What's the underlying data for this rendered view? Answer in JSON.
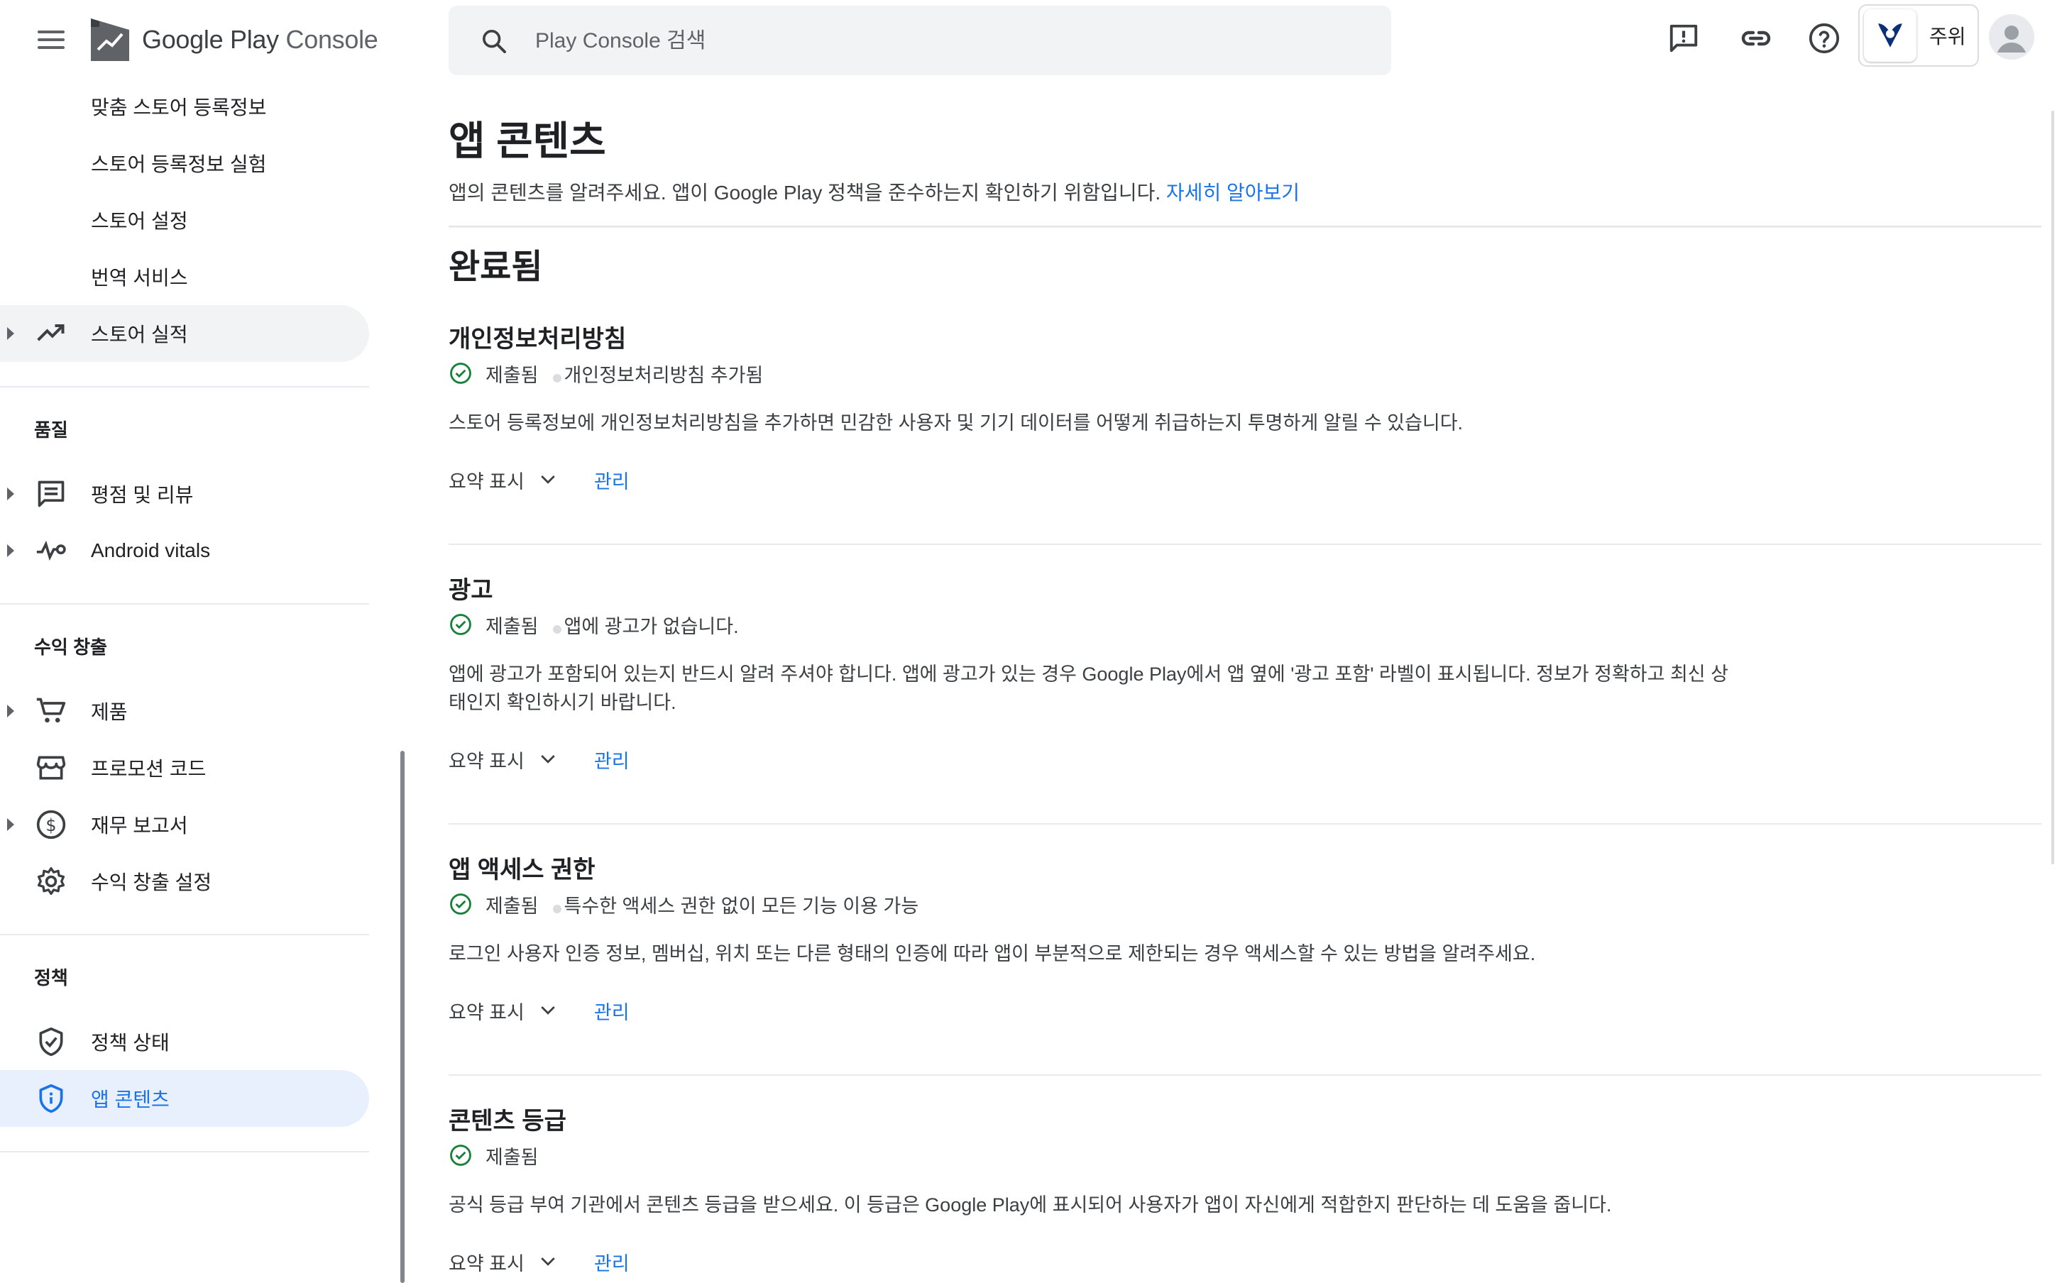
{
  "app": {
    "logo_prefix": "Google Play",
    "logo_suffix": "Console"
  },
  "search": {
    "placeholder": "Play Console 검색"
  },
  "header": {
    "account_label": "주위"
  },
  "sidebar": {
    "store_items": [
      {
        "label": "맞춤 스토어 등록정보"
      },
      {
        "label": "스토어 등록정보 실험"
      },
      {
        "label": "스토어 설정"
      },
      {
        "label": "번역 서비스"
      },
      {
        "label": "스토어 실적"
      }
    ],
    "quality_section": "품질",
    "quality_items": [
      {
        "label": "평점 및 리뷰"
      },
      {
        "label": "Android vitals"
      }
    ],
    "monetize_section": "수익 창출",
    "monetize_items": [
      {
        "label": "제품"
      },
      {
        "label": "프로모션 코드"
      },
      {
        "label": "재무 보고서"
      },
      {
        "label": "수익 창출 설정"
      }
    ],
    "policy_section": "정책",
    "policy_items": [
      {
        "label": "정책 상태"
      },
      {
        "label": "앱 콘텐츠"
      }
    ]
  },
  "main": {
    "title": "앱 콘텐츠",
    "description": "앱의 콘텐츠를 알려주세요. 앱이 Google Play 정책을 준수하는지 확인하기 위함입니다.",
    "learn_more": "자세히 알아보기",
    "section_title": "완료됨",
    "cards": [
      {
        "title": "개인정보처리방침",
        "status": "제출됨",
        "detail": "개인정보처리방침 추가됨",
        "description": "스토어 등록정보에 개인정보처리방침을 추가하면 민감한 사용자 및 기기 데이터를 어떻게 취급하는지 투명하게 알릴 수 있습니다.",
        "summary_label": "요약 표시",
        "manage_label": "관리"
      },
      {
        "title": "광고",
        "status": "제출됨",
        "detail": "앱에 광고가 없습니다.",
        "description": "앱에 광고가 포함되어 있는지 반드시 알려 주셔야 합니다. 앱에 광고가 있는 경우 Google Play에서 앱 옆에 '광고 포함' 라벨이 표시됩니다. 정보가 정확하고 최신 상태인지 확인하시기 바랍니다.",
        "summary_label": "요약 표시",
        "manage_label": "관리"
      },
      {
        "title": "앱 액세스 권한",
        "status": "제출됨",
        "detail": "특수한 액세스 권한 없이 모든 기능 이용 가능",
        "description": "로그인 사용자 인증 정보, 멤버십, 위치 또는 다른 형태의 인증에 따라 앱이 부분적으로 제한되는 경우 액세스할 수 있는 방법을 알려주세요.",
        "summary_label": "요약 표시",
        "manage_label": "관리"
      },
      {
        "title": "콘텐츠 등급",
        "status": "제출됨",
        "detail": "",
        "description": "공식 등급 부여 기관에서 콘텐츠 등급을 받으세요. 이 등급은 Google Play에 표시되어 사용자가 앱이 자신에게 적합한지 판단하는 데 도움을 줍니다.",
        "summary_label": "요약 표시",
        "manage_label": "관리"
      }
    ]
  },
  "colors": {
    "accent": "#1a73e8",
    "success": "#188038",
    "active_bg": "#e8f0fe",
    "search_bg": "#f1f3f4"
  },
  "icons": {
    "menu": "menu-icon",
    "search": "search-icon",
    "feedback": "feedback-icon",
    "link": "link-icon",
    "help": "help-icon",
    "account": "avatar-icon"
  }
}
